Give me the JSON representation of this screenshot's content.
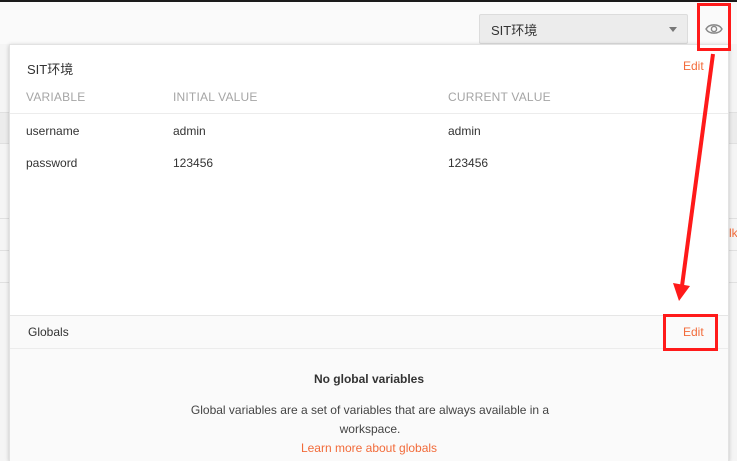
{
  "environment_selector": {
    "selected": "SIT环境"
  },
  "background": {
    "partial_link_text": "lk"
  },
  "quick_look": {
    "environment": {
      "name": "SIT环境",
      "edit_label": "Edit",
      "columns": [
        "VARIABLE",
        "INITIAL VALUE",
        "CURRENT VALUE"
      ],
      "rows": [
        {
          "variable": "username",
          "initial": "admin",
          "current": "admin"
        },
        {
          "variable": "password",
          "initial": "123456",
          "current": "123456"
        }
      ]
    },
    "globals": {
      "title": "Globals",
      "edit_label": "Edit",
      "empty_title": "No global variables",
      "empty_description": "Global variables are a set of variables that are always available in a workspace.",
      "learn_more": "Learn more about globals"
    }
  },
  "icons": {
    "eye": "eye-icon",
    "caret": "chevron-down-icon"
  },
  "colors": {
    "accent": "#f26b3a",
    "annotation": "#ff1a1a"
  }
}
